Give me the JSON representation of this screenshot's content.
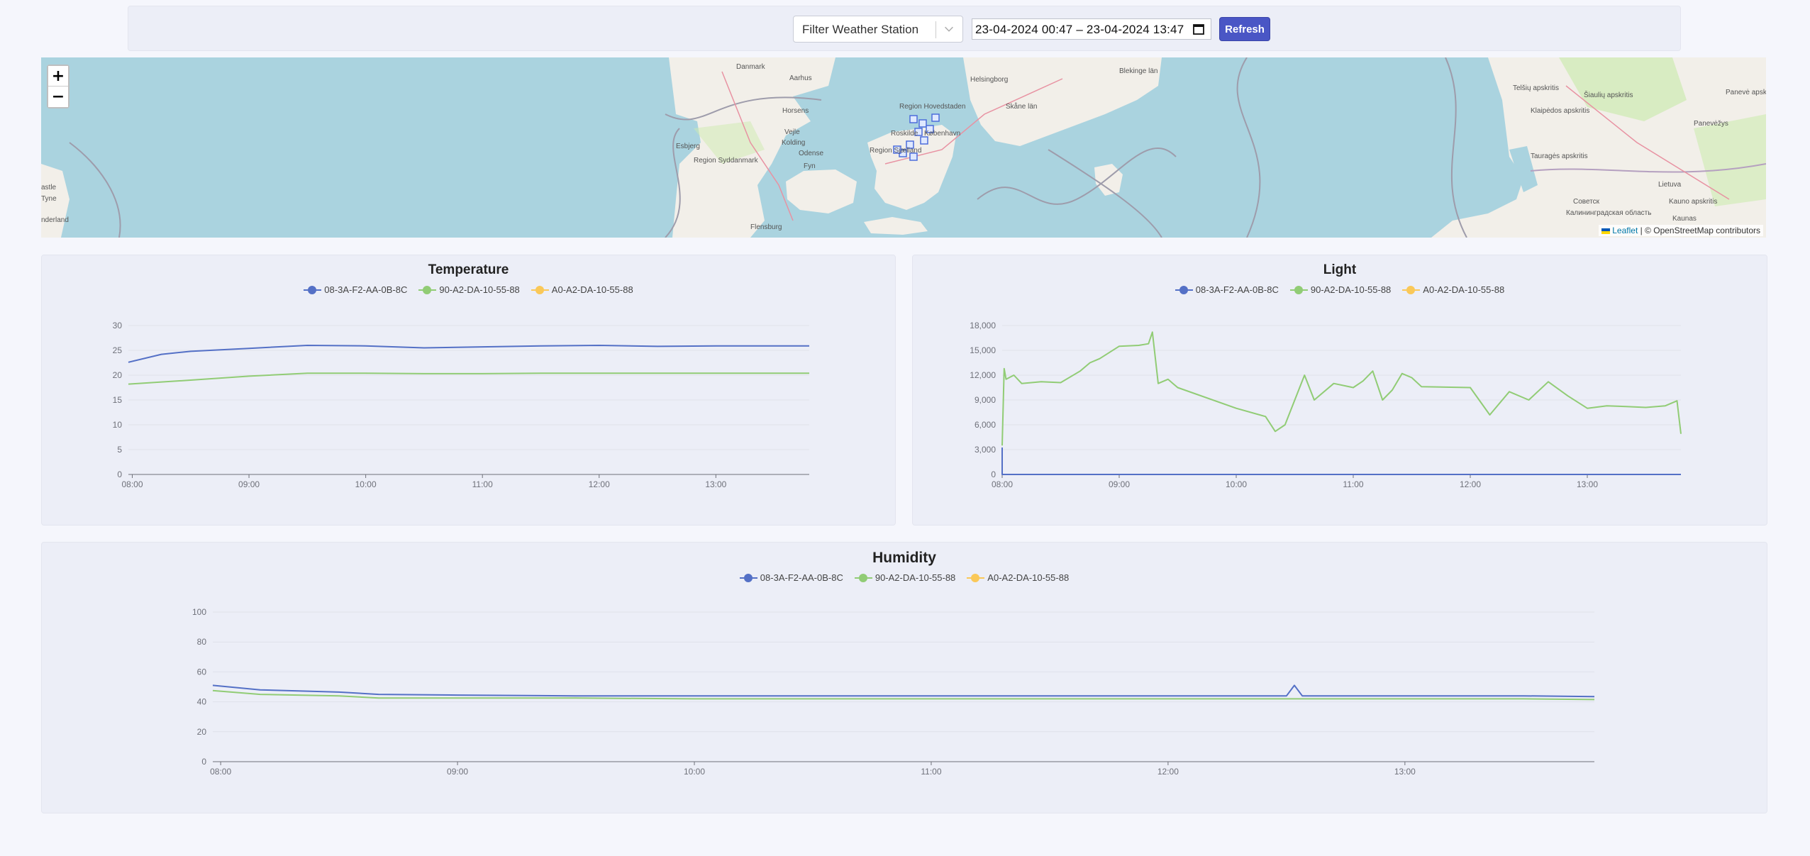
{
  "toolbar": {
    "filter_placeholder": "Filter Weather Station",
    "date_range": "23-04-2024 00:47 – 23-04-2024 13:47",
    "refresh_label": "Refresh"
  },
  "map": {
    "zoom_in": "+",
    "zoom_out": "−",
    "attribution_leaflet": "Leaflet",
    "attribution_rest": "| © OpenStreetMap contributors",
    "labels": [
      "Danmark",
      "Aarhus",
      "Horsens",
      "Vejle",
      "Kolding",
      "Esbjerg",
      "Odense",
      "Fyn",
      "Region Syddanmark",
      "Flensburg",
      "Helsingborg",
      "Region Hovedstaden",
      "Skåne län",
      "København",
      "Roskilde",
      "Region Sjælland",
      "Blekinge län",
      "Telšių apskritis",
      "Šiaulių apskritis",
      "Panevėžys",
      "Klaipėdos apskritis",
      "Tauragės apskritis",
      "Lietuva",
      "Kauno apskritis",
      "Kaunas",
      "Советск",
      "Калининградская область",
      "astle",
      "Tyne",
      "nderland",
      "Panevė apskrit"
    ]
  },
  "colors": {
    "series1": "#5470c6",
    "series2": "#91cc75",
    "series3": "#fac858"
  },
  "chart_data": [
    {
      "type": "line",
      "title": "Temperature",
      "series": [
        {
          "name": "08-3A-F2-AA-0B-8C",
          "x": [
            "07:58",
            "08:15",
            "08:30",
            "09:00",
            "09:30",
            "10:00",
            "10:30",
            "11:00",
            "11:30",
            "12:00",
            "12:30",
            "13:00",
            "13:48"
          ],
          "values": [
            22.6,
            24.2,
            24.8,
            25.4,
            26.0,
            25.9,
            25.5,
            25.7,
            25.9,
            26.0,
            25.8,
            25.9,
            25.9
          ]
        },
        {
          "name": "90-A2-DA-10-55-88",
          "x": [
            "07:58",
            "08:30",
            "09:00",
            "09:30",
            "10:00",
            "10:30",
            "11:00",
            "11:30",
            "12:00",
            "12:30",
            "13:00",
            "13:48"
          ],
          "values": [
            18.2,
            19.0,
            19.8,
            20.4,
            20.4,
            20.3,
            20.3,
            20.4,
            20.4,
            20.4,
            20.4,
            20.4
          ]
        },
        {
          "name": "A0-A2-DA-10-55-88",
          "x": [],
          "values": []
        }
      ],
      "xticks": [
        "08:00",
        "09:00",
        "10:00",
        "11:00",
        "12:00",
        "13:00"
      ],
      "yticks": [
        0,
        5,
        10,
        15,
        20,
        25,
        30
      ],
      "ylim": [
        0,
        30
      ],
      "xlim": [
        "07:58",
        "13:48"
      ],
      "legend": "top"
    },
    {
      "type": "line",
      "title": "Light",
      "series": [
        {
          "name": "08-3A-F2-AA-0B-8C",
          "x": [
            "08:00",
            "08:00",
            "08:00",
            "08:01",
            "13:48"
          ],
          "values": [
            0,
            3200,
            0,
            0,
            0
          ]
        },
        {
          "name": "90-A2-DA-10-55-88",
          "x": [
            "08:00",
            "08:01",
            "08:02",
            "08:06",
            "08:10",
            "08:20",
            "08:30",
            "08:40",
            "08:45",
            "08:50",
            "09:00",
            "09:10",
            "09:15",
            "09:17",
            "09:20",
            "09:25",
            "09:30",
            "10:00",
            "10:15",
            "10:20",
            "10:25",
            "10:35",
            "10:40",
            "10:50",
            "11:00",
            "11:05",
            "11:10",
            "11:15",
            "11:20",
            "11:25",
            "11:30",
            "11:35",
            "12:00",
            "12:10",
            "12:20",
            "12:30",
            "12:40",
            "12:50",
            "13:00",
            "13:10",
            "13:20",
            "13:30",
            "13:40",
            "13:46",
            "13:48"
          ],
          "values": [
            3500,
            12800,
            11500,
            12000,
            11000,
            11200,
            11100,
            12500,
            13500,
            14000,
            15500,
            15600,
            15800,
            17200,
            11000,
            11500,
            10500,
            8000,
            7000,
            5200,
            6000,
            12000,
            9000,
            11000,
            10500,
            11300,
            12500,
            9000,
            10200,
            12200,
            11700,
            10600,
            10500,
            7200,
            10000,
            9000,
            11200,
            9500,
            8000,
            8300,
            8200,
            8100,
            8300,
            8900,
            4900
          ]
        },
        {
          "name": "A0-A2-DA-10-55-88",
          "x": [],
          "values": []
        }
      ],
      "xticks": [
        "08:00",
        "09:00",
        "10:00",
        "11:00",
        "12:00",
        "13:00"
      ],
      "yticks": [
        "0",
        "3,000",
        "6,000",
        "9,000",
        "12,000",
        "15,000",
        "18,000"
      ],
      "ylim": [
        0,
        18000
      ],
      "xlim": [
        "08:00",
        "13:48"
      ],
      "legend": "top"
    },
    {
      "type": "line",
      "title": "Humidity",
      "series": [
        {
          "name": "08-3A-F2-AA-0B-8C",
          "x": [
            "07:58",
            "08:10",
            "08:30",
            "08:40",
            "09:00",
            "09:30",
            "10:00",
            "10:30",
            "11:00",
            "11:30",
            "12:00",
            "12:30",
            "12:32",
            "12:34",
            "13:00",
            "13:30",
            "13:48"
          ],
          "values": [
            51,
            48,
            46.5,
            45,
            44.5,
            44,
            44,
            44,
            44,
            44,
            44,
            44,
            51,
            44,
            44,
            44,
            43.5
          ]
        },
        {
          "name": "90-A2-DA-10-55-88",
          "x": [
            "07:58",
            "08:10",
            "08:30",
            "08:40",
            "09:00",
            "09:30",
            "10:00",
            "10:30",
            "11:00",
            "11:30",
            "12:00",
            "12:30",
            "13:00",
            "13:30",
            "13:48"
          ],
          "values": [
            47.5,
            45,
            44,
            42.5,
            42.5,
            42.5,
            42,
            42,
            42,
            42,
            42,
            42,
            42,
            42,
            41.5
          ]
        },
        {
          "name": "A0-A2-DA-10-55-88",
          "x": [],
          "values": []
        }
      ],
      "xticks": [
        "08:00",
        "09:00",
        "10:00",
        "11:00",
        "12:00",
        "13:00"
      ],
      "yticks": [
        0,
        20,
        40,
        60,
        80,
        100
      ],
      "ylim": [
        0,
        100
      ],
      "xlim": [
        "07:58",
        "13:48"
      ],
      "legend": "top"
    }
  ]
}
